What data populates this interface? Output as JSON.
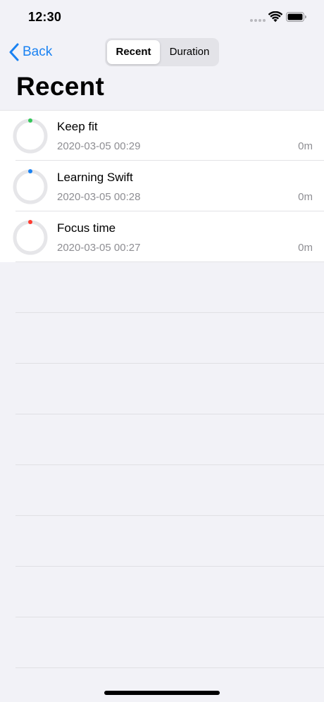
{
  "status_bar": {
    "time": "12:30"
  },
  "nav": {
    "back_label": "Back",
    "segments": [
      {
        "label": "Recent",
        "selected": true
      },
      {
        "label": "Duration",
        "selected": false
      }
    ]
  },
  "page": {
    "title": "Recent"
  },
  "items": [
    {
      "title": "Keep fit",
      "timestamp": "2020-03-05 00:29",
      "duration": "0m",
      "color": "#34c759",
      "progress": 0
    },
    {
      "title": "Learning Swift",
      "timestamp": "2020-03-05 00:28",
      "duration": "0m",
      "color": "#1a82f2",
      "progress": 0
    },
    {
      "title": "Focus time",
      "timestamp": "2020-03-05 00:27",
      "duration": "0m",
      "color": "#ff3b30",
      "progress": 0
    }
  ],
  "icons": {
    "back": "chevron-left-icon",
    "wifi": "wifi-icon",
    "battery": "battery-icon",
    "signal": "cellular-signal-icon"
  },
  "colors": {
    "accent": "#1a82f2",
    "background": "#f2f2f7",
    "secondary_text": "#8e8e93"
  }
}
